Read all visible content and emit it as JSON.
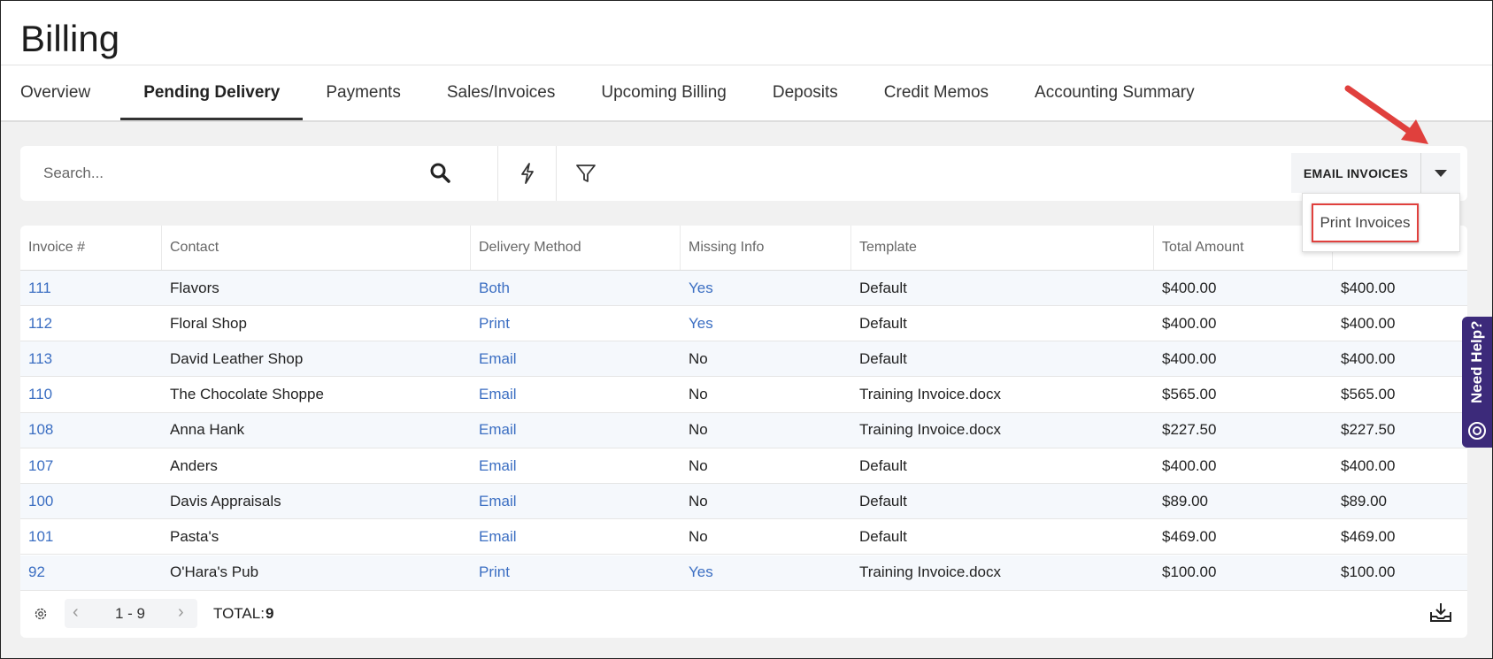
{
  "page_title": "Billing",
  "tabs": [
    "Overview",
    "Pending Delivery",
    "Payments",
    "Sales/Invoices",
    "Upcoming Billing",
    "Deposits",
    "Credit Memos",
    "Accounting Summary"
  ],
  "active_tab": "Pending Delivery",
  "search": {
    "placeholder": "Search..."
  },
  "email_button": "EMAIL INVOICES",
  "dropdown": {
    "items": [
      "Print Invoices"
    ]
  },
  "table": {
    "headers": [
      "Invoice #",
      "Contact",
      "Delivery Method",
      "Missing Info",
      "Template",
      "Total Amount",
      ""
    ],
    "rows": [
      [
        "111",
        "Flavors",
        "Both",
        "Yes",
        "Default",
        "$400.00",
        "$400.00"
      ],
      [
        "112",
        "Floral Shop",
        "Print",
        "Yes",
        "Default",
        "$400.00",
        "$400.00"
      ],
      [
        "113",
        "David Leather Shop",
        "Email",
        "No",
        "Default",
        "$400.00",
        "$400.00"
      ],
      [
        "110",
        "The Chocolate Shoppe",
        "Email",
        "No",
        "Training Invoice.docx",
        "$565.00",
        "$565.00"
      ],
      [
        "108",
        "Anna Hank",
        "Email",
        "No",
        "Training Invoice.docx",
        "$227.50",
        "$227.50"
      ],
      [
        "107",
        "Anders",
        "Email",
        "No",
        "Default",
        "$400.00",
        "$400.00"
      ],
      [
        "100",
        "Davis Appraisals",
        "Email",
        "No",
        "Default",
        "$89.00",
        "$89.00"
      ],
      [
        "101",
        "Pasta's",
        "Email",
        "No",
        "Default",
        "$469.00",
        "$469.00"
      ],
      [
        "92",
        "O'Hara's Pub",
        "Print",
        "Yes",
        "Training Invoice.docx",
        "$100.00",
        "$100.00"
      ]
    ]
  },
  "footer": {
    "range": "1 - 9",
    "total_label": "TOTAL:",
    "total": "9"
  },
  "help_tab": "Need Help?",
  "colors": {
    "link": "#3b6ec2",
    "annotation": "#e0403d",
    "help": "#3c2a7a"
  }
}
